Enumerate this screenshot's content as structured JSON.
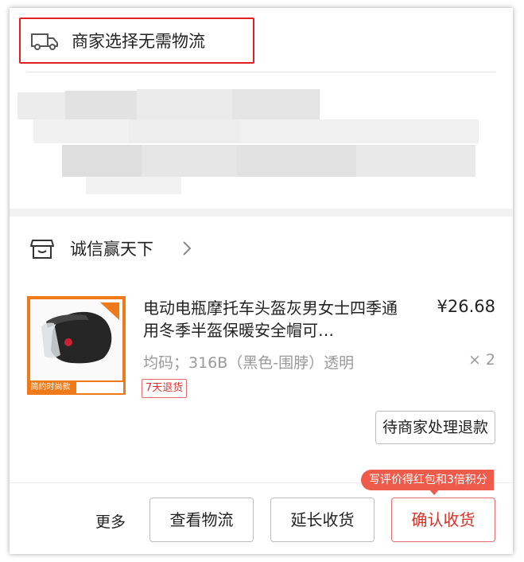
{
  "logistics": {
    "label": "商家选择无需物流",
    "icon": "truck-icon"
  },
  "shop": {
    "name": "诚信赢天下",
    "icon": "shop-icon",
    "chevron": "chevron-right-icon"
  },
  "product": {
    "title": "电动电瓶摩托车头盔灰男女士四季通用冬季半盔保暖安全帽可…",
    "price": "¥26.68",
    "sku": "均码；316B（黑色-围脖）透明",
    "quantity": "× 2",
    "return_badge": "7天退货",
    "refund_status": "待商家处理退款",
    "thumb_footer": "简约时尚款"
  },
  "actions": {
    "more": "更多",
    "view_logistics": "查看物流",
    "extend_receipt": "延长收货",
    "confirm_receipt": "确认收货",
    "promo": "写评价得红包和3倍积分"
  },
  "colors": {
    "accent": "#e02020",
    "promo": "#ee5b4a",
    "thumb": "#f07a1a"
  }
}
